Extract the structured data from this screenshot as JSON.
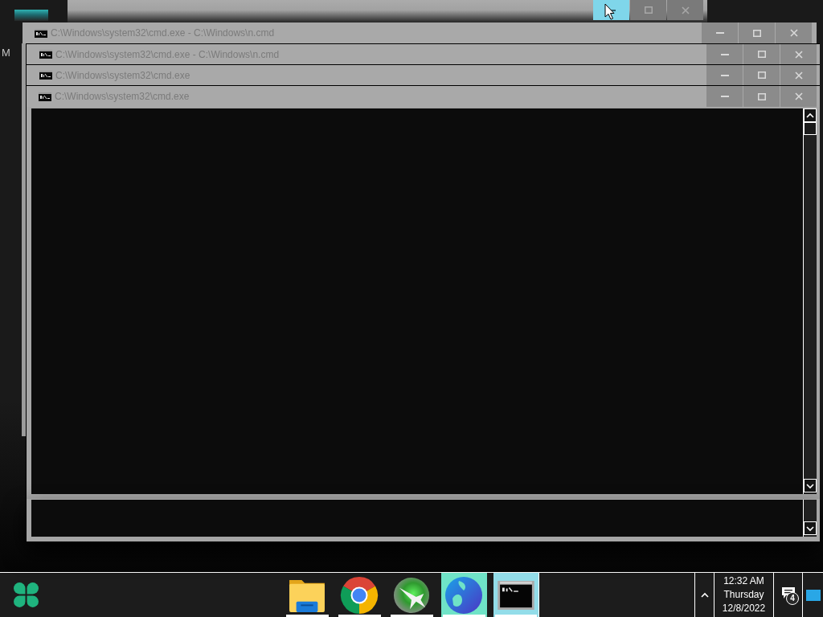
{
  "desktop": {
    "icon_labels": [
      "M"
    ]
  },
  "background_window": {
    "buttons": [
      {
        "kind": "minimize",
        "hovered": true
      },
      {
        "kind": "maximize",
        "hovered": false
      },
      {
        "kind": "close",
        "hovered": false
      }
    ]
  },
  "windows": [
    {
      "title": "C:\\Windows\\system32\\cmd.exe - C:\\Windows\\n.cmd"
    },
    {
      "title": "C:\\Windows\\system32\\cmd.exe - C:\\Windows\\n.cmd"
    },
    {
      "title": "C:\\Windows\\system32\\cmd.exe"
    },
    {
      "title": "C:\\Windows\\system32\\cmd.exe"
    }
  ],
  "taskbar": {
    "apps": [
      {
        "kind": "folder",
        "active": false,
        "flashing": false,
        "running": true
      },
      {
        "kind": "browser",
        "active": false,
        "flashing": false,
        "running": true
      },
      {
        "kind": "jet",
        "active": false,
        "flashing": false,
        "running": true
      },
      {
        "kind": "sphere",
        "active": false,
        "flashing": true,
        "running": true
      },
      {
        "kind": "console",
        "active": true,
        "flashing": false,
        "running": true
      }
    ],
    "clock": {
      "time": "12:32 AM",
      "day": "Thursday",
      "date": "12/8/2022"
    },
    "notifications": {
      "count": "4"
    }
  }
}
